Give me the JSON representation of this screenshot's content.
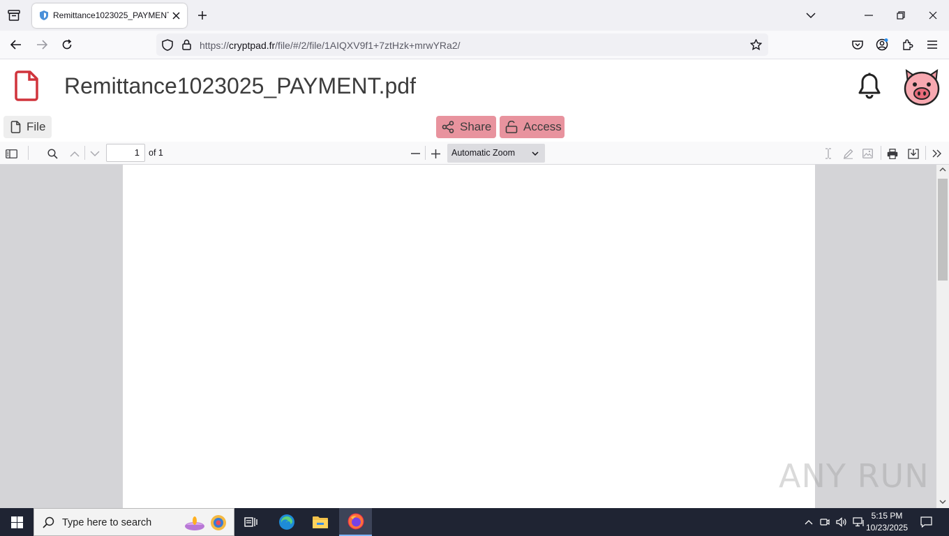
{
  "browser": {
    "tab_title": "Remittance1023025_PAYMENT.pdf",
    "url_prefix": "https://",
    "url_domain": "cryptpad.fr",
    "url_path": "/file/#/2/file/1AIQXV9f1+7ztHzk+mrwYRa2/"
  },
  "app": {
    "doc_title": "Remittance1023025_PAYMENT.pdf",
    "file_label": "File",
    "share_label": "Share",
    "access_label": "Access",
    "accent_color": "#e8939e"
  },
  "pdf_toolbar": {
    "page_number": "1",
    "page_of": "of 1",
    "zoom": "Automatic Zoom"
  },
  "watermark": "ANY RUN",
  "taskbar": {
    "search_placeholder": "Type here to search",
    "time": "5:15 PM",
    "date": "10/23/2025"
  }
}
